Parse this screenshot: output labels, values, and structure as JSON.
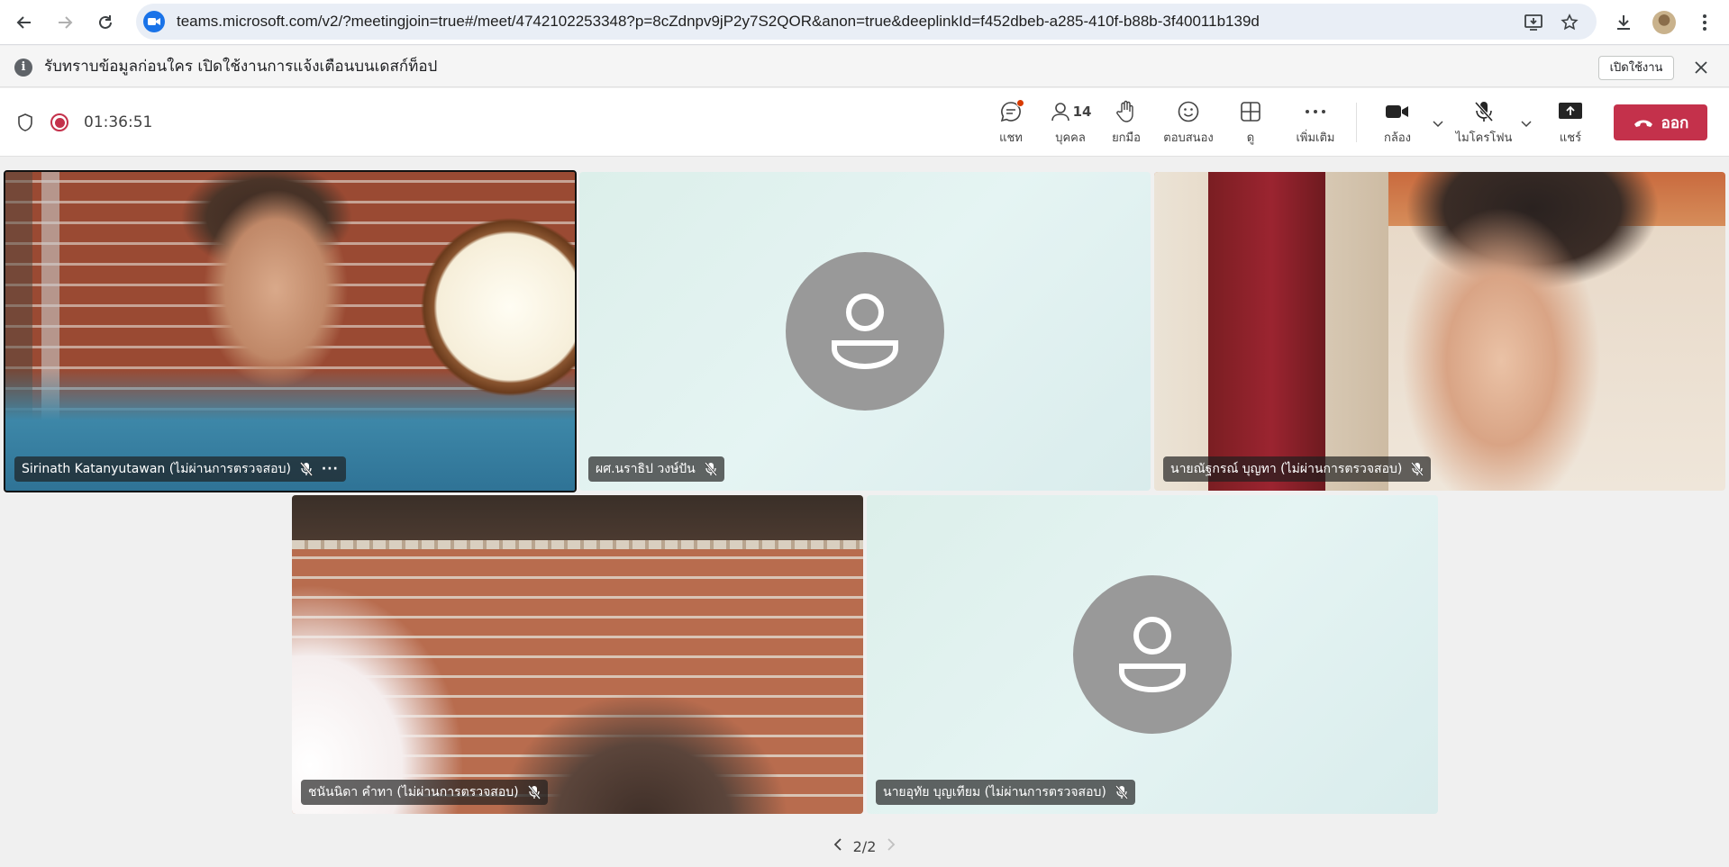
{
  "browser": {
    "url": "teams.microsoft.com/v2/?meetingjoin=true#/meet/4742102253348?p=8cZdnpv9jP2y7S2QOR&anon=true&deeplinkId=f452dbeb-a285-410f-b88b-3f40011b139d"
  },
  "infobar": {
    "message": "รับทราบข้อมูลก่อนใคร เปิดใช้งานการแจ้งเตือนบนเดสก์ท็อป",
    "enable_label": "เปิดใช้งาน"
  },
  "toolbar": {
    "timer": "01:36:51",
    "chat_label": "แชท",
    "people_label": "บุคคล",
    "people_count": "14",
    "raise_label": "ยกมือ",
    "react_label": "ตอบสนอง",
    "view_label": "ดู",
    "more_label": "เพิ่มเติม",
    "camera_label": "กล้อง",
    "mic_label": "ไมโครโฟน",
    "share_label": "แชร์",
    "leave_label": "ออก"
  },
  "participants": [
    {
      "name": "Sirinath Katanyutawan (ไม่ผ่านการตรวจสอบ)",
      "video": true,
      "muted": true
    },
    {
      "name": "ผศ.นราธิป วงษ์ปัน",
      "video": false,
      "muted": true
    },
    {
      "name": "นายณัฐกรณ์ บุญทา (ไม่ผ่านการตรวจสอบ)",
      "video": true,
      "muted": true
    },
    {
      "name": "ชนันนิดา คำทา (ไม่ผ่านการตรวจสอบ)",
      "video": true,
      "muted": true
    },
    {
      "name": "นายอุทัย บุญเทียม (ไม่ผ่านการตรวจสอบ)",
      "video": false,
      "muted": true
    }
  ],
  "pager": {
    "label": "2/2"
  },
  "colors": {
    "leave": "#c4314b",
    "record": "#c4314b",
    "avatar": "#999999",
    "chat_badge": "#d83b01"
  }
}
